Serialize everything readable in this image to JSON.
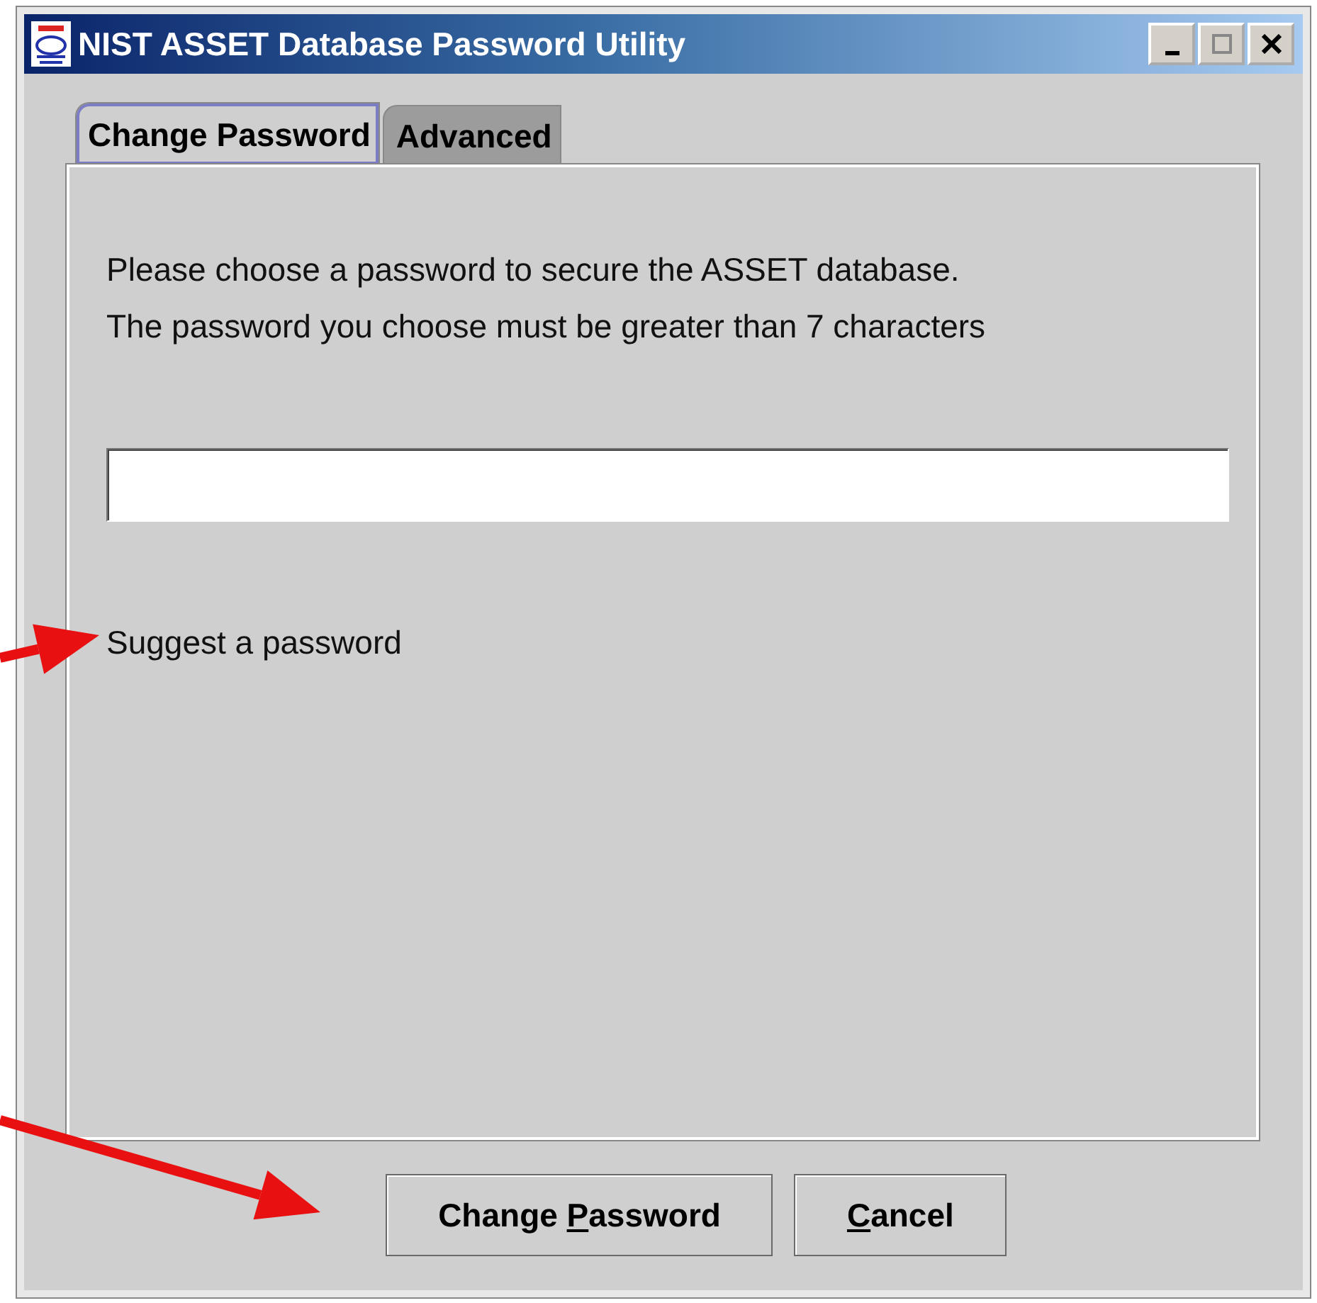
{
  "window": {
    "title": "NIST ASSET Database Password Utility"
  },
  "tabs": [
    {
      "label": "Change Password",
      "selected": true
    },
    {
      "label": "Advanced",
      "selected": false
    }
  ],
  "instructions": [
    "Please choose a password to secure the ASSET database.",
    "The password you choose must be greater than 7 characters"
  ],
  "suggest_link": "Suggest a password",
  "buttons": [
    {
      "before": "Change ",
      "mnemonic": "P",
      "after": "assword"
    },
    {
      "mnemonic": "C",
      "after": "ancel"
    }
  ],
  "annotations": [
    {
      "kind": "arrow"
    },
    {
      "kind": "arrow"
    }
  ]
}
